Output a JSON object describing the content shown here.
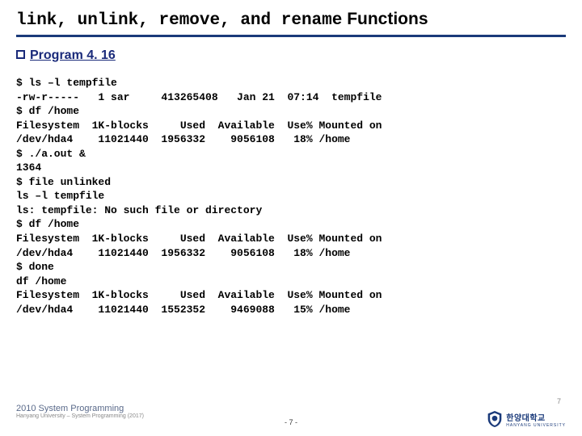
{
  "title_parts": {
    "f1": "link",
    "c1": ", ",
    "f2": "unlink",
    "c2": ", ",
    "f3": "remove",
    "c3": ", and ",
    "f4": "rename",
    "suffix": " Functions"
  },
  "subhead": "Program 4. 16",
  "terminal": "$ ls –l tempfile\n-rw-r-----   1 sar     413265408   Jan 21  07:14  tempfile\n$ df /home\nFilesystem  1K-blocks     Used  Available  Use% Mounted on\n/dev/hda4    11021440  1956332    9056108   18% /home\n$ ./a.out &\n1364\n$ file unlinked\nls –l tempfile\nls: tempfile: No such file or directory\n$ df /home\nFilesystem  1K-blocks     Used  Available  Use% Mounted on\n/dev/hda4    11021440  1956332    9056108   18% /home\n$ done\ndf /home\nFilesystem  1K-blocks     Used  Available  Use% Mounted on\n/dev/hda4    11021440  1552352    9469088   15% /home",
  "footer": {
    "course": "2010 System Programming",
    "small": "Hanyang University – System Programming (2017)",
    "page": "- 7 -",
    "corner": "7",
    "uni_kr": "한양대학교",
    "uni_en": "HANYANG UNIVERSITY"
  }
}
